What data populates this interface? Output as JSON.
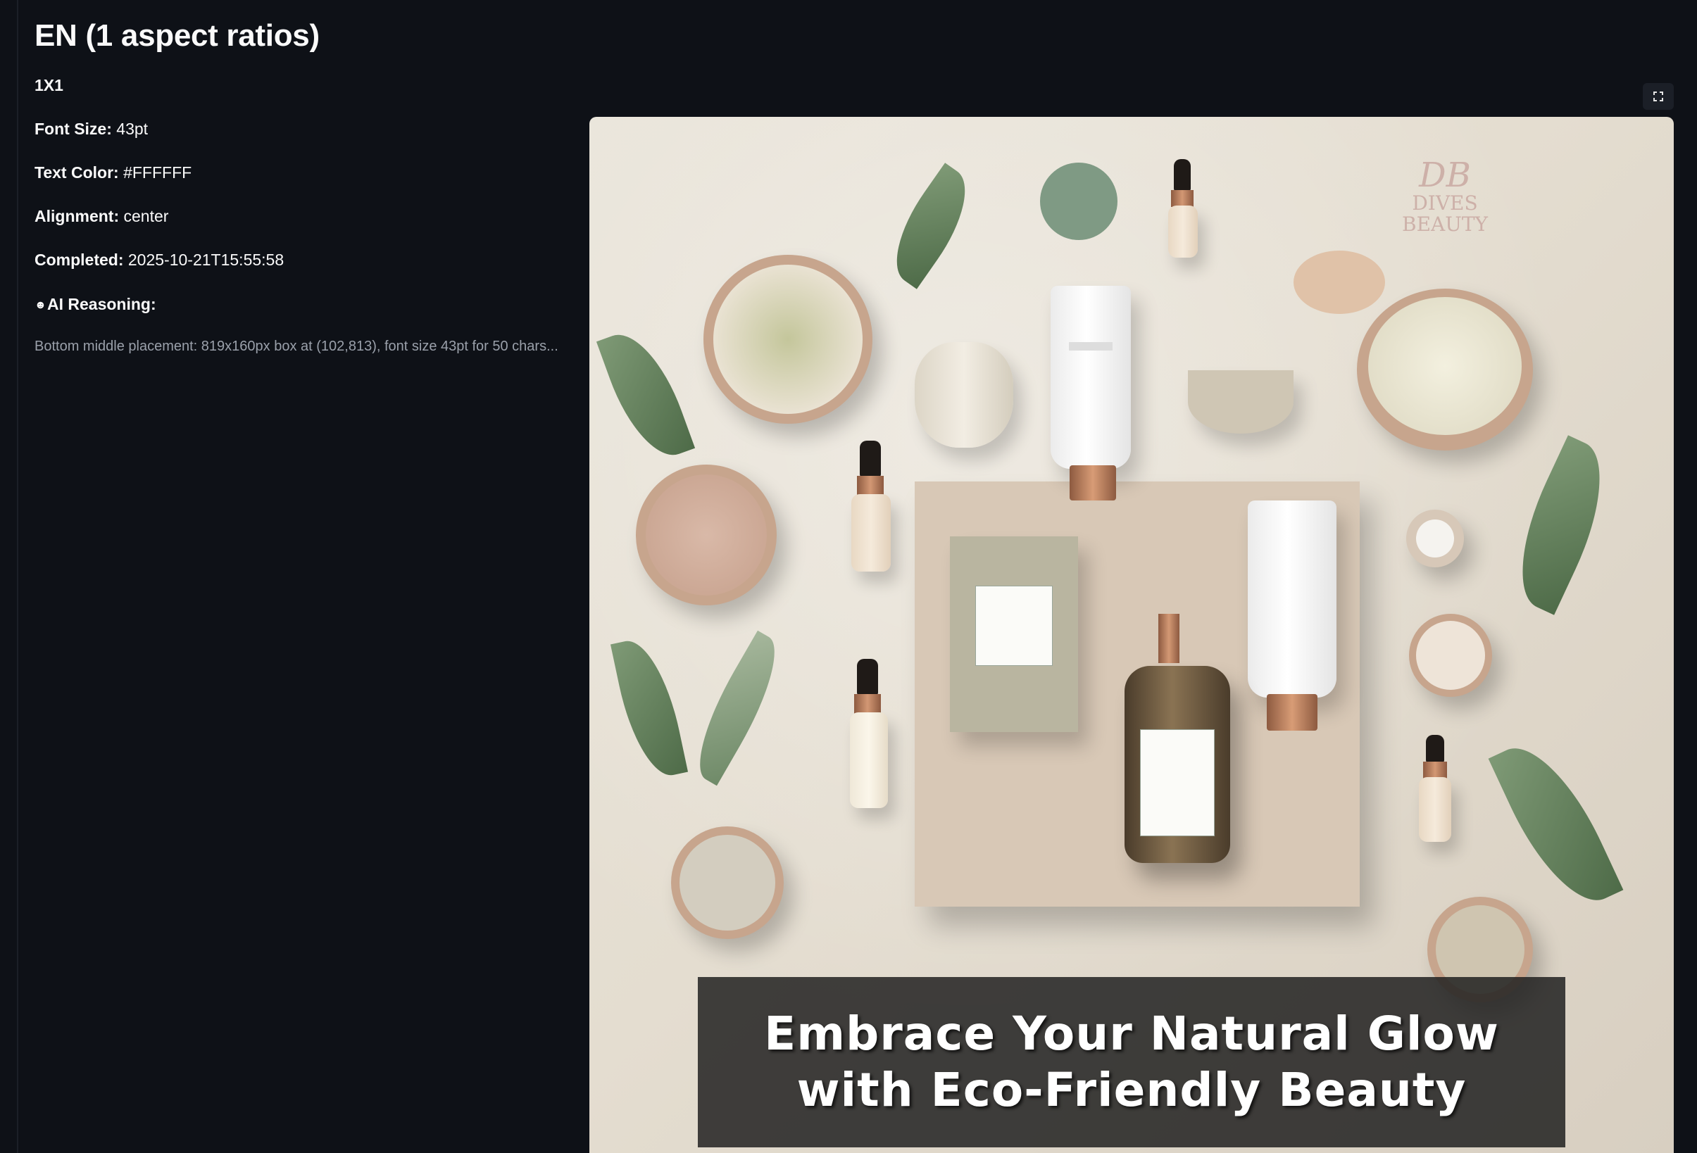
{
  "header": {
    "title": "EN (1 aspect ratios)"
  },
  "ratio": {
    "label": "1X1"
  },
  "fields": {
    "font_size": {
      "label": "Font Size:",
      "value": "43pt"
    },
    "text_color": {
      "label": "Text Color:",
      "value": "#FFFFFF"
    },
    "alignment": {
      "label": "Alignment:",
      "value": "center"
    },
    "completed": {
      "label": "Completed:",
      "value": "2025-10-21T15:55:58"
    }
  },
  "reasoning": {
    "icon": "brain-icon",
    "label": "AI Reasoning:",
    "text": "Bottom middle placement: 819x160px box at (102,813), font size 43pt for 50 chars..."
  },
  "image": {
    "caption_line1": "Embrace Your Natural Glow",
    "caption_line2": "with Eco-Friendly Beauty",
    "watermark_monogram": "DB",
    "watermark_line1": "DIVES",
    "watermark_line2": "BEAUTY",
    "caption_color": "#FFFFFF"
  },
  "toolbar": {
    "expand_icon": "fullscreen-icon"
  },
  "colors": {
    "background": "#0e1117",
    "text": "#fafafa",
    "muted": "#9aa0aa"
  }
}
